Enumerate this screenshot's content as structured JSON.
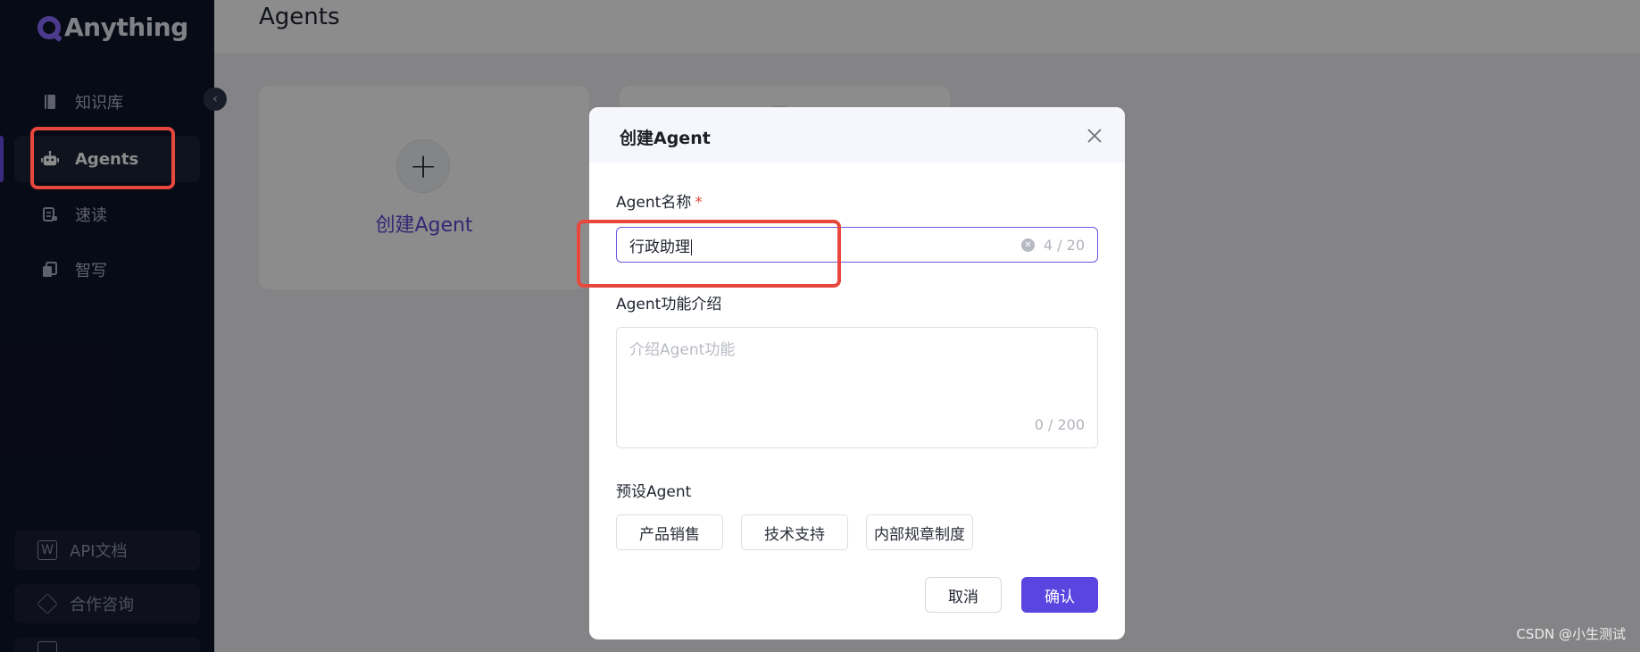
{
  "app": {
    "brand": "Anything"
  },
  "sidebar": {
    "items": [
      {
        "label": "知识库",
        "icon": "book-icon"
      },
      {
        "label": "Agents",
        "icon": "robot-icon",
        "active": true
      },
      {
        "label": "速读",
        "icon": "scroll-icon"
      },
      {
        "label": "智写",
        "icon": "copy-doc-icon"
      }
    ],
    "bottom": [
      {
        "label": "API文档",
        "icon": "word-doc-icon"
      },
      {
        "label": "合作咨询",
        "icon": "handshake-icon"
      }
    ]
  },
  "header": {
    "title": "Agents"
  },
  "cards": {
    "create_label": "创建Agent"
  },
  "modal": {
    "title": "创建Agent",
    "name_label": "Agent名称",
    "required_mark": "*",
    "name_value": "行政助理",
    "name_counter": "4 / 20",
    "desc_label": "Agent功能介绍",
    "desc_placeholder": "介绍Agent功能",
    "desc_counter": "0 / 200",
    "preset_label": "预设Agent",
    "presets": [
      "产品销售",
      "技术支持",
      "内部规章制度"
    ],
    "cancel_label": "取消",
    "confirm_label": "确认"
  },
  "watermark": "CSDN @小生测试",
  "colors": {
    "accent": "#5b45e0",
    "sidebar_bg": "#0e1428",
    "annotation": "#e8473e"
  }
}
